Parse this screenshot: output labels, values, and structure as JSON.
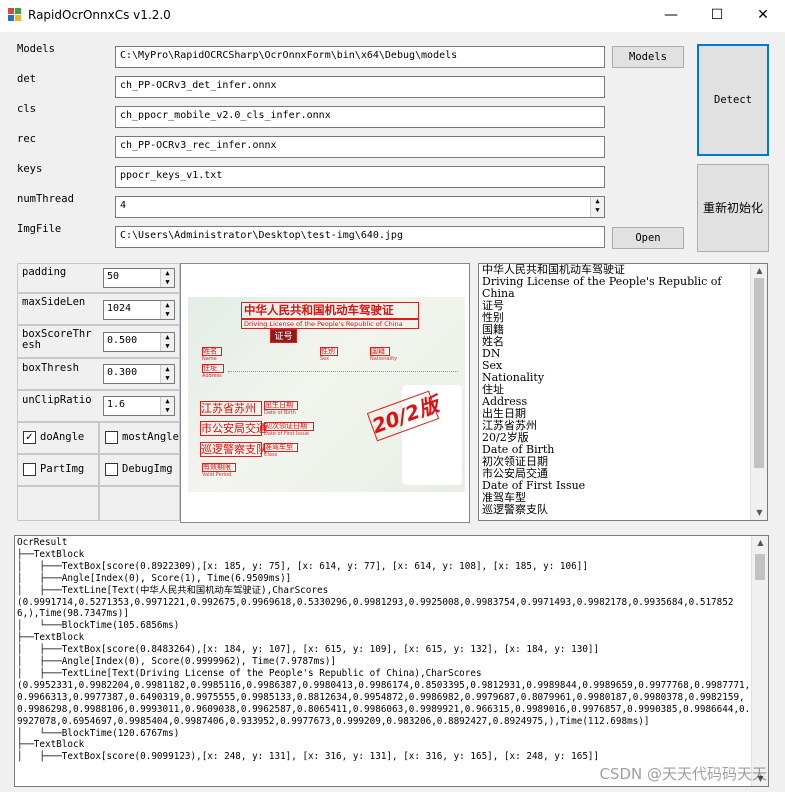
{
  "window": {
    "title": "RapidOcrOnnxCs v1.2.0",
    "minimize": "—",
    "maximize": "☐",
    "close": "✕"
  },
  "fields": {
    "models": {
      "label": "Models",
      "value": "C:\\MyPro\\RapidOCRCSharp\\OcrOnnxForm\\bin\\x64\\Debug\\models"
    },
    "det": {
      "label": "det",
      "value": "ch_PP-OCRv3_det_infer.onnx"
    },
    "cls": {
      "label": "cls",
      "value": "ch_ppocr_mobile_v2.0_cls_infer.onnx"
    },
    "rec": {
      "label": "rec",
      "value": "ch_PP-OCRv3_rec_infer.onnx"
    },
    "keys": {
      "label": "keys",
      "value": "ppocr_keys_v1.txt"
    },
    "numThread": {
      "label": "numThread",
      "value": "4"
    },
    "imgFile": {
      "label": "ImgFile",
      "value": "C:\\Users\\Administrator\\Desktop\\test-img\\640.jpg"
    }
  },
  "buttons": {
    "models": "Models",
    "open": "Open",
    "detect": "Detect",
    "reinit": "重新初始化"
  },
  "params": {
    "padding": {
      "label": "padding",
      "value": "50"
    },
    "maxSideLen": {
      "label": "maxSideLen",
      "value": "1024"
    },
    "boxScoreThresh": {
      "label": "boxScoreThr\nesh",
      "value": "0.500"
    },
    "boxThresh": {
      "label": "boxThresh",
      "value": "0.300"
    },
    "unClipRatio": {
      "label": "unClipRatio",
      "value": "1.6"
    }
  },
  "checks": {
    "doAngle": {
      "label": "doAngle",
      "checked": true,
      "mark": "✓"
    },
    "mostAngle": {
      "label": "mostAngle",
      "checked": false
    },
    "partImg": {
      "label": "PartImg",
      "checked": false
    },
    "debugImg": {
      "label": "DebugImg",
      "checked": false
    }
  },
  "card": {
    "title": "中华人民共和国机动车驾驶证",
    "subtitle": "Driving License of the People's Republic of China",
    "cert": "证号",
    "name": "姓名",
    "name_en": "Name",
    "sex": "性别",
    "sex_en": "Sex",
    "nationality": "国籍",
    "nationality_en": "Nationality",
    "address": "住址",
    "address_en": "Address",
    "dob": "出生日期",
    "dob_en": "Date of Birth",
    "issue": "初次领证日期",
    "issue_en": "Date of First Issue",
    "class": "准驾车型",
    "class_en": "Class",
    "valid": "有效期限",
    "valid_en": "Valid Period",
    "seal1": "江苏省苏州",
    "seal2": "市公安局交通",
    "seal3": "巡逻警察支队",
    "stamp": "20/2版"
  },
  "results": [
    "中华人民共和国机动车驾驶证",
    "Driving License of the People's Republic of",
    "China",
    "证号",
    "性别",
    "国籍",
    "姓名",
    "DN",
    "Sex",
    "Nationality",
    "住址",
    "Address",
    "出生日期",
    "江苏省苏州",
    "20/2岁版",
    "Date of Birth",
    "初次领证日期",
    "市公安局交通",
    "Date of First Issue",
    "准驾车型",
    "巡逻警察支队"
  ],
  "log": "OcrResult\n├──TextBlock\n│   ├───TextBox[score(0.8922309),[x: 185, y: 75], [x: 614, y: 77], [x: 614, y: 108], [x: 185, y: 106]]\n│   ├───Angle[Index(0), Score(1), Time(6.9509ms)]\n│   ├───TextLine[Text(中华人民共和国机动车驾驶证),CharScores\n(0.9991714,0.5271353,0.9971221,0.992675,0.9969618,0.5330296,0.9981293,0.9925008,0.9983754,0.9971493,0.9982178,0.9935684,0.5178526,),Time(98.7347ms)]\n│   └───BlockTime(105.6856ms)\n├──TextBlock\n│   ├───TextBox[score(0.8483264),[x: 184, y: 107], [x: 615, y: 109], [x: 615, y: 132], [x: 184, y: 130]]\n│   ├───Angle[Index(0), Score(0.9999962), Time(7.9787ms)]\n│   ├───TextLine[Text(Driving License of the People's Republic of China),CharScores\n(0.9952331,0.9982204,0.9981182,0.9985116,0.9986387,0.9980413,0.9986174,0.8503395,0.9812931,0.9989844,0.9989659,0.9977768,0.9987771,0.9966313,0.9977387,0.6490319,0.9975555,0.9985133,0.8812634,0.9954872,0.9986982,0.9979687,0.8079961,0.9980187,0.9980378,0.9982159,0.9986298,0.9988106,0.9993011,0.9609038,0.9962587,0.8065411,0.9986063,0.9989921,0.966315,0.9989016,0.9976857,0.9990385,0.9986644,0.9927078,0.6954697,0.9985404,0.9987406,0.933952,0.9977673,0.999209,0.983206,0.8892427,0.8924975,),Time(112.698ms)]\n│   └───BlockTime(120.6767ms)\n├──TextBlock\n│   ├───TextBox[score(0.9099123),[x: 248, y: 131], [x: 316, y: 131], [x: 316, y: 165], [x: 248, y: 165]]",
  "watermark": "CSDN @天天代码码天天"
}
